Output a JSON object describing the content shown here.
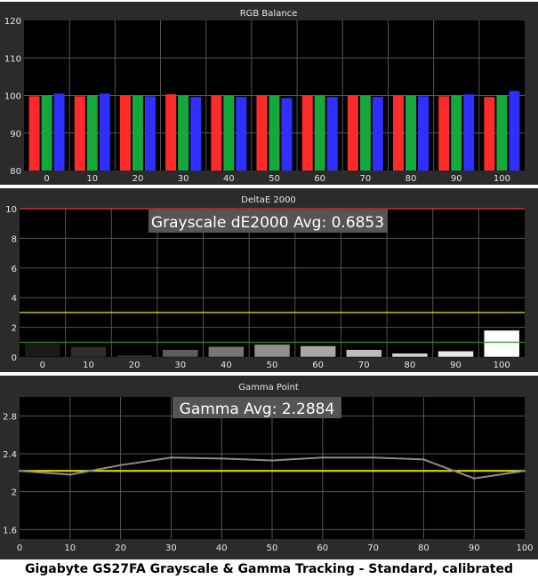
{
  "caption": "Gigabyte GS27FA Grayscale & Gamma Tracking - Standard, calibrated",
  "colors": {
    "panel_bg": "#2b2b2b",
    "plot_bg": "#000000",
    "grid": "#555555",
    "text": "#e6e6e6",
    "red": "#ff2b2b",
    "green": "#15a83a",
    "blue": "#2f2fff",
    "reference_yellow": "#e6e600",
    "reference_green": "#1c9a1c",
    "reference_red": "#ff3030",
    "gamma_line": "#8c8c8c",
    "gamma_target": "#e6e600",
    "annotation_bg": "#555555"
  },
  "chart_data": [
    {
      "type": "bar",
      "title": "RGB Balance",
      "categories": [
        "0",
        "10",
        "20",
        "30",
        "40",
        "50",
        "60",
        "70",
        "80",
        "90",
        "100"
      ],
      "ylim": [
        80,
        120
      ],
      "yticks": [
        80,
        90,
        100,
        110,
        120
      ],
      "grid": true,
      "series": [
        {
          "color_key": "red",
          "values": [
            99.8,
            99.8,
            100.0,
            100.3,
            100.0,
            100.0,
            100.0,
            100.0,
            100.0,
            99.8,
            99.6
          ]
        },
        {
          "color_key": "green",
          "values": [
            100.0,
            100.1,
            100.0,
            100.0,
            100.0,
            100.0,
            100.0,
            100.0,
            100.0,
            100.0,
            100.1
          ]
        },
        {
          "color_key": "blue",
          "values": [
            100.5,
            100.5,
            99.8,
            99.6,
            99.6,
            99.3,
            99.6,
            99.6,
            99.8,
            100.3,
            101.2
          ]
        }
      ]
    },
    {
      "type": "bar",
      "title": "DeltaE 2000",
      "annotation": "Grayscale dE2000 Avg: 0.6853",
      "categories": [
        "0",
        "10",
        "20",
        "30",
        "40",
        "50",
        "60",
        "70",
        "80",
        "90",
        "100"
      ],
      "ylim": [
        0,
        10
      ],
      "yticks": [
        0,
        2,
        4,
        6,
        8,
        10
      ],
      "grid": true,
      "values": [
        0.95,
        0.7,
        0.1,
        0.5,
        0.7,
        0.85,
        0.75,
        0.5,
        0.25,
        0.4,
        1.8
      ],
      "bar_fills": [
        "#1a1a1a",
        "#2e2e2e",
        "#474747",
        "#5e5e5e",
        "#777777",
        "#8f8f8f",
        "#a6a6a6",
        "#bdbdbd",
        "#d4d4d4",
        "#e9e9e9",
        "#ffffff"
      ],
      "reference_lines": [
        {
          "value": 10,
          "color_key": "reference_red"
        },
        {
          "value": 3,
          "color_key": "reference_yellow"
        },
        {
          "value": 1,
          "color_key": "reference_green"
        }
      ]
    },
    {
      "type": "line",
      "title": "Gamma Point",
      "annotation": "Gamma Avg: 2.2884",
      "x": [
        0,
        10,
        20,
        30,
        40,
        50,
        60,
        70,
        80,
        90,
        100
      ],
      "xlim": [
        0,
        100
      ],
      "xticks": [
        0,
        10,
        20,
        30,
        40,
        50,
        60,
        70,
        80,
        90,
        100
      ],
      "ylim": [
        1.5,
        3.0
      ],
      "yticks": [
        1.6,
        2.0,
        2.4,
        2.8
      ],
      "grid": true,
      "values": [
        2.22,
        2.18,
        2.28,
        2.36,
        2.35,
        2.33,
        2.36,
        2.36,
        2.34,
        2.14,
        2.22
      ],
      "target": 2.22
    }
  ]
}
